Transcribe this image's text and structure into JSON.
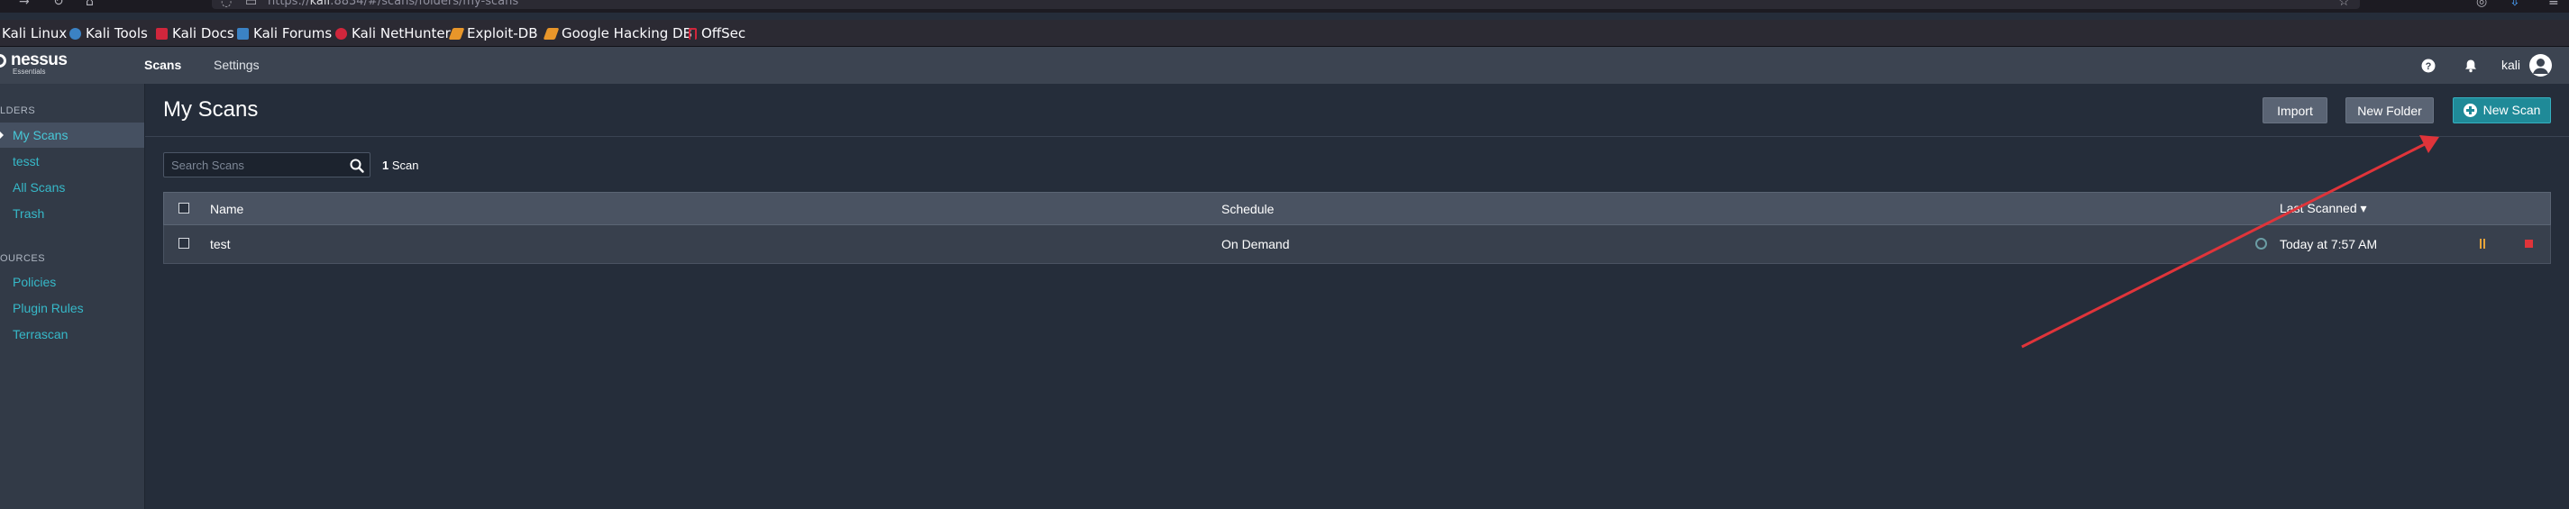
{
  "browser": {
    "url_prefix": "https://",
    "url_host": "kali",
    "url_rest": ":8834/#/scans/folders/my-scans",
    "bookmarks": [
      {
        "label": "Kali Linux",
        "icon": "kali-dragon-icon",
        "color": "#3b82c4"
      },
      {
        "label": "Kali Tools",
        "icon": "kali-tools-icon",
        "color": "#d04a4a"
      },
      {
        "label": "Kali Docs",
        "icon": "kali-docs-icon",
        "color": "#d0263c"
      },
      {
        "label": "Kali Forums",
        "icon": "kali-forums-icon",
        "color": "#3b82c4"
      },
      {
        "label": "Kali NetHunter",
        "icon": "nethunter-icon",
        "color": "#d0263c"
      },
      {
        "label": "Exploit-DB",
        "icon": "exploit-db-icon",
        "color": "#e8962a"
      },
      {
        "label": "Google Hacking DB",
        "icon": "ghdb-icon",
        "color": "#e8962a"
      },
      {
        "label": "OffSec",
        "icon": "offsec-icon",
        "color": "#d0263c"
      }
    ]
  },
  "app": {
    "logo": "nessus",
    "logo_sub": "Essentials",
    "nav": {
      "scans": "Scans",
      "settings": "Settings"
    },
    "user": "kali",
    "help_icon": "help-icon",
    "bell_icon": "bell-icon"
  },
  "sidebar": {
    "folders_heading": "LDERS",
    "folders": [
      {
        "label": "My Scans",
        "active": true
      },
      {
        "label": "tesst",
        "active": false
      },
      {
        "label": "All Scans",
        "active": false
      },
      {
        "label": "Trash",
        "active": false
      }
    ],
    "resources_heading": "OURCES",
    "resources": [
      {
        "label": "Policies"
      },
      {
        "label": "Plugin Rules"
      },
      {
        "label": "Terrascan"
      }
    ]
  },
  "main": {
    "title": "My Scans",
    "buttons": {
      "import": "Import",
      "new_folder": "New Folder",
      "new_scan": "New Scan"
    },
    "search_placeholder": "Search Scans",
    "count_number": "1",
    "count_label": "Scan",
    "columns": {
      "name": "Name",
      "schedule": "Schedule",
      "last_scanned": "Last Scanned ▾"
    },
    "rows": [
      {
        "name": "test",
        "schedule": "On Demand",
        "last_scanned": "Today at 7:57 AM"
      }
    ]
  },
  "colors": {
    "accent": "#1f8a98",
    "link": "#36b9c9",
    "annotation_arrow": "#e0343a"
  }
}
